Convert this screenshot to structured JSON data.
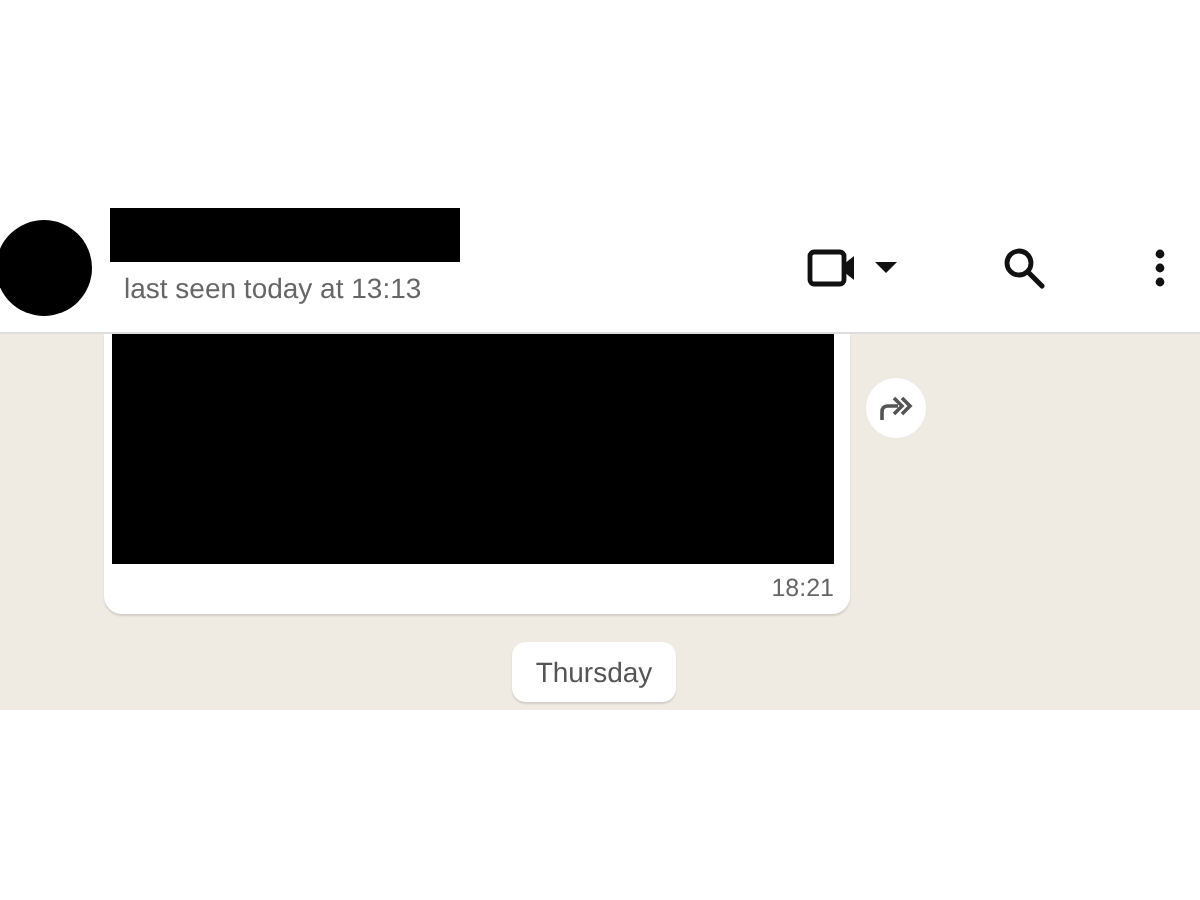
{
  "header": {
    "status": "last seen today at 13:13"
  },
  "message": {
    "time": "18:21"
  },
  "date_divider": {
    "label": "Thursday"
  }
}
